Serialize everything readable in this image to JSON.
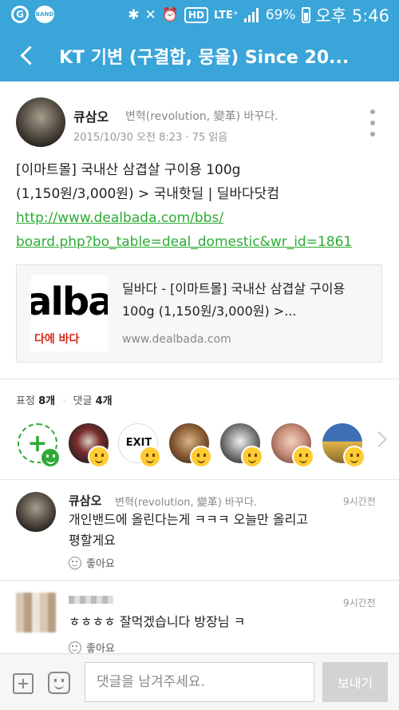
{
  "status_bar": {
    "left_icons": [
      "g-icon",
      "band-icon"
    ],
    "right_icons": [
      "bluetooth-icon",
      "mute-icon",
      "alarm-icon",
      "hd-icon",
      "lte-icon",
      "signal-icon",
      "battery-icon"
    ],
    "g_label": "G",
    "band_label": "BAND",
    "hd_label": "HD",
    "lte_label": "LTE⁺",
    "battery": "69%",
    "time": "오후 5:46"
  },
  "header": {
    "title": "KT 기변 (구결합, 뭉올) Since 20...",
    "color": "#3aa5d8"
  },
  "post": {
    "author": "큐삼오",
    "tagline": "변혁(revolution, 變革) 바꾸다.",
    "meta": "2015/10/30 오전 8:23 · 75 읽음",
    "body_lines": [
      "[이마트몰] 국내산 삼겹살 구이용 100g",
      "(1,150원/3,000원) > 국내핫딜 | 딜바다닷컴"
    ],
    "link_lines": [
      "http://www.dealbada.com/bbs/",
      "board.php?bo_table=deal_domestic&wr_id=1861"
    ],
    "link_color": "#2dab35",
    "preview": {
      "thumb_text": "alba",
      "thumb_sub": "다에 바다",
      "title": "딜바다 - [이마트몰] 국내산 삼겹살 구이용 100g (1,150원/3,000원) >...",
      "url": "www.dealbada.com"
    }
  },
  "reactions": {
    "label": "표정",
    "count": "8개",
    "comment_label": "댓글",
    "comment_count": "4개",
    "reactor_exit_label": "EXIT"
  },
  "comments": [
    {
      "author": "큐삼오",
      "tagline": "변혁(revolution, 變革) 바꾸다.",
      "time": "9시간전",
      "text_lines": [
        "개인밴드에 올린다는게 ㅋㅋㅋ 오늘만 올리고",
        "평할게요"
      ],
      "like_label": "좋아요"
    },
    {
      "author": "",
      "time": "9시간전",
      "text_lines": [
        "ㅎㅎㅎㅎ 잘먹겠습니다 방장님 ㅋ"
      ],
      "like_label": "좋아요"
    }
  ],
  "input_bar": {
    "placeholder": "댓글을 남겨주세요.",
    "send_label": "보내기"
  }
}
